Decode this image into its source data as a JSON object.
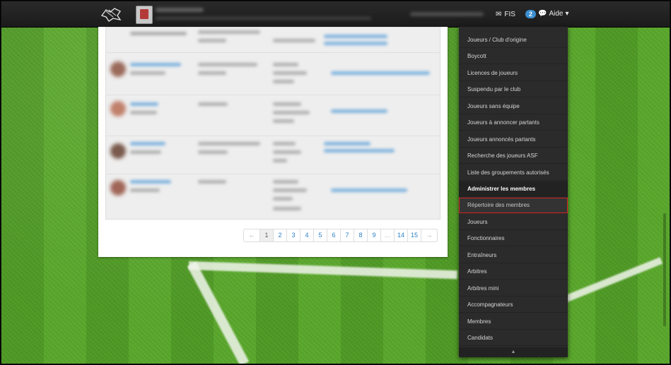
{
  "nav": {
    "fis_label": "FIS",
    "fis_count": "2",
    "help_label": "Aide",
    "help_caret": "▾"
  },
  "pagination": {
    "prev": "←",
    "pages": [
      "1",
      "2",
      "3",
      "4",
      "5",
      "6",
      "7",
      "8",
      "9",
      "…",
      "14",
      "15"
    ],
    "next": "→",
    "active": "1"
  },
  "menu": {
    "items": [
      "Joueurs / Club d'origine",
      "Boycott",
      "Licences de joueurs",
      "Suspendu par le club",
      "Joueurs sans équipe",
      "Joueurs à annoncer partants",
      "Joueurs annoncés partants",
      "Recherche des joueurs ASF",
      "Liste des groupements autorisés"
    ],
    "section_header": "Administrer les membres",
    "highlighted": "Répertoire des membres",
    "section_items": [
      "Joueurs",
      "Fonctionnaires",
      "Entraîneurs",
      "Arbitres",
      "Arbitres mini",
      "Accompagnateurs",
      "Membres",
      "Candidats"
    ],
    "scroll_indicator": "▲"
  },
  "colors": {
    "navbar": "#1b1b1b",
    "menu_bg": "#2b2b2b",
    "highlight_border": "#d62222",
    "badge": "#3b8fd0",
    "link": "#2a7fc4"
  }
}
